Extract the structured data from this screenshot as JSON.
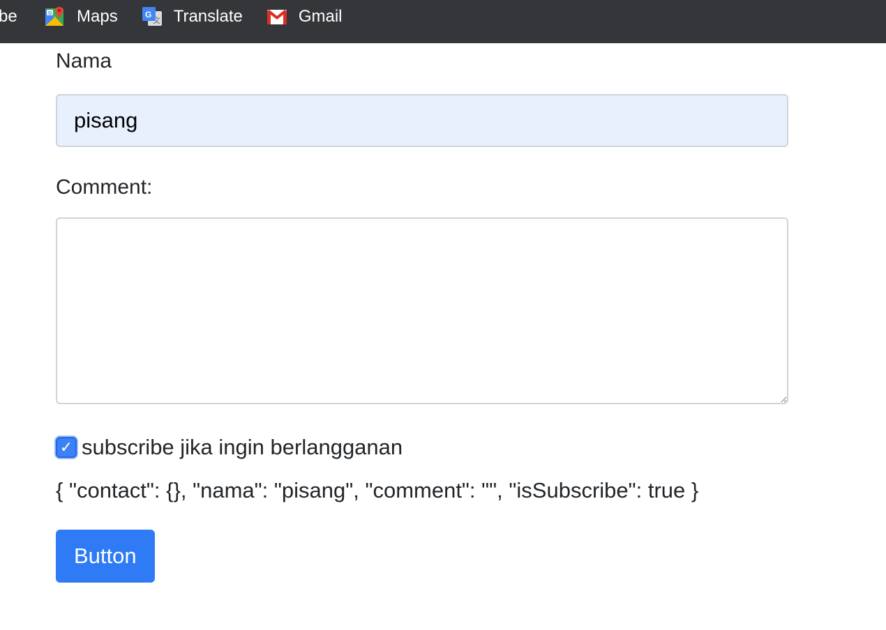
{
  "bookmarks": {
    "partial_label": "be",
    "items": [
      {
        "label": "Maps",
        "icon": "maps-icon"
      },
      {
        "label": "Translate",
        "icon": "translate-icon"
      },
      {
        "label": "Gmail",
        "icon": "gmail-icon"
      }
    ]
  },
  "form": {
    "nama_label": "Nama",
    "nama_value": "pisang",
    "comment_label": "Comment:",
    "comment_value": "",
    "subscribe_checked": true,
    "subscribe_label": "subscribe jika ingin berlangganan",
    "json_output": "{ \"contact\": {}, \"nama\": \"pisang\", \"comment\": \"\", \"isSubscribe\": true }",
    "button_label": "Button"
  },
  "colors": {
    "bookmarks_bar_bg": "#35363a",
    "input_autofill_bg": "#e8f0fe",
    "primary": "#2f7bf5",
    "checkbox": "#3b82f6"
  }
}
